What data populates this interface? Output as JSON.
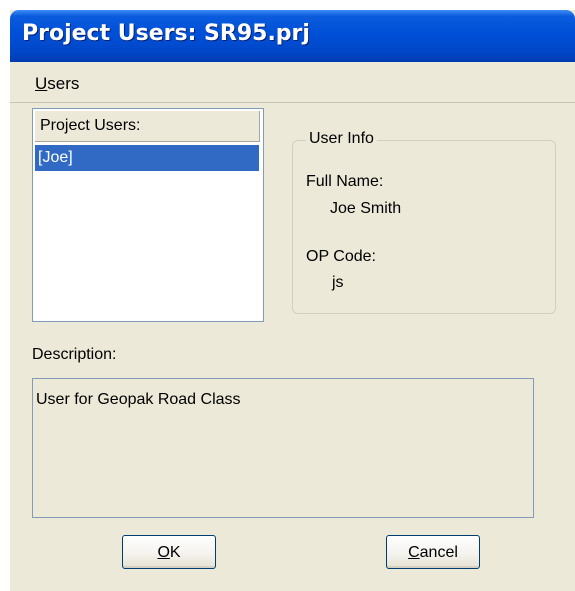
{
  "window": {
    "title": "Project Users: SR95.prj"
  },
  "menubar": {
    "items": [
      {
        "label_mnemonic": "U",
        "label_rest": "sers"
      }
    ]
  },
  "users_list": {
    "header": "Project Users:",
    "items": [
      {
        "label": "[Joe]",
        "selected": true
      }
    ]
  },
  "user_info": {
    "group_title": "User Info",
    "full_name_label": "Full Name:",
    "full_name_value": "Joe Smith",
    "op_code_label": "OP Code:",
    "op_code_value": "js"
  },
  "description": {
    "label": "Description:",
    "text": "User for Geopak Road Class"
  },
  "buttons": {
    "ok": {
      "mnemonic": "O",
      "rest": "K"
    },
    "cancel": {
      "mnemonic": "C",
      "rest": "ancel"
    }
  },
  "colors": {
    "titlebar": "#0050d8",
    "selection": "#316ac5",
    "dialog_bg": "#ece9d8"
  }
}
